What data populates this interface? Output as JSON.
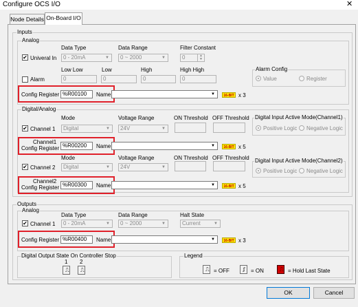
{
  "window": {
    "title": "Configure OCS I/O",
    "close": "✕"
  },
  "tabs": [
    {
      "label": "Node Details"
    },
    {
      "label": "On-Board I/O"
    }
  ],
  "inputs": {
    "title": "Inputs",
    "analog": {
      "title": "Analog",
      "headers": {
        "data_type": "Data Type",
        "data_range": "Data Range",
        "filter_constant": "Filter Constant",
        "low_low": "Low Low",
        "low": "Low",
        "high": "High",
        "high_high": "High High"
      },
      "universal_in": {
        "label": "Univeral In",
        "checked": "✔",
        "data_type": "0 - 20mA",
        "data_range": "0 ~ 2000",
        "filter": "0"
      },
      "alarm": {
        "label": "Alarm",
        "low_low": "0",
        "low": "0",
        "high": "0",
        "high_high": "0"
      },
      "alarm_config": {
        "title": "Alarm Config",
        "value": "Value",
        "register": "Register"
      },
      "config_register": {
        "label": "Config Register",
        "value": "%R00100",
        "name_label": "Name:",
        "bit": "16-BIT",
        "mult": "x 3"
      }
    },
    "digital_analog": {
      "title": "Digital/Analog",
      "headers": {
        "mode": "Mode",
        "voltage_range": "Voltage Range",
        "on_threshold": "ON Threshold",
        "off_threshold": "OFF Threshold"
      },
      "channel1": {
        "label": "Channel 1",
        "checked": "✔",
        "mode": "Digital",
        "voltage": "24V",
        "active_mode": {
          "title": "Digital Input Active Mode(Channel1)",
          "positive": "Positive Logic",
          "negative": "Negative Logic"
        },
        "register": {
          "label1": "Channel1",
          "label2": "Config Register",
          "value": "%R00200",
          "name_label": "Name:",
          "bit": "16-BIT",
          "mult": "x 5"
        }
      },
      "channel2": {
        "label": "Channel 2",
        "checked": "✔",
        "mode": "Digital",
        "voltage": "24V",
        "active_mode": {
          "title": "Digital Input Active Mode(Channel2)",
          "positive": "Positive Logic",
          "negative": "Negative Logic"
        },
        "register": {
          "label1": "Channel2",
          "label2": "Config Register",
          "value": "%R00300",
          "name_label": "Name:",
          "bit": "16-BIT",
          "mult": "x 5"
        }
      }
    }
  },
  "outputs": {
    "title": "Outputs",
    "analog": {
      "title": "Analog",
      "headers": {
        "data_type": "Data Type",
        "data_range": "Data Range",
        "halt_state": "Halt State"
      },
      "channel1": {
        "label": "Channel 1",
        "checked": "✔",
        "data_type": "0 - 20mA",
        "data_range": "0 ~ 2000",
        "halt": "Current"
      },
      "config_register": {
        "label": "Config Register",
        "value": "%R00400",
        "name_label": "Name:",
        "bit": "16-BIT",
        "mult": "x 3"
      }
    },
    "digital_stop": {
      "title": "Digital Output State On Controller Stop",
      "ch1": "1",
      "ch2": "2"
    },
    "legend": {
      "title": "Legend",
      "off": "= OFF",
      "on": "= ON",
      "hold": "= Hold Last State"
    }
  },
  "buttons": {
    "ok": "OK",
    "cancel": "Cancel"
  },
  "colors": {
    "highlight": "#e0202a",
    "bit_badge": "#ffe800",
    "hold_icon": "#d00000"
  }
}
